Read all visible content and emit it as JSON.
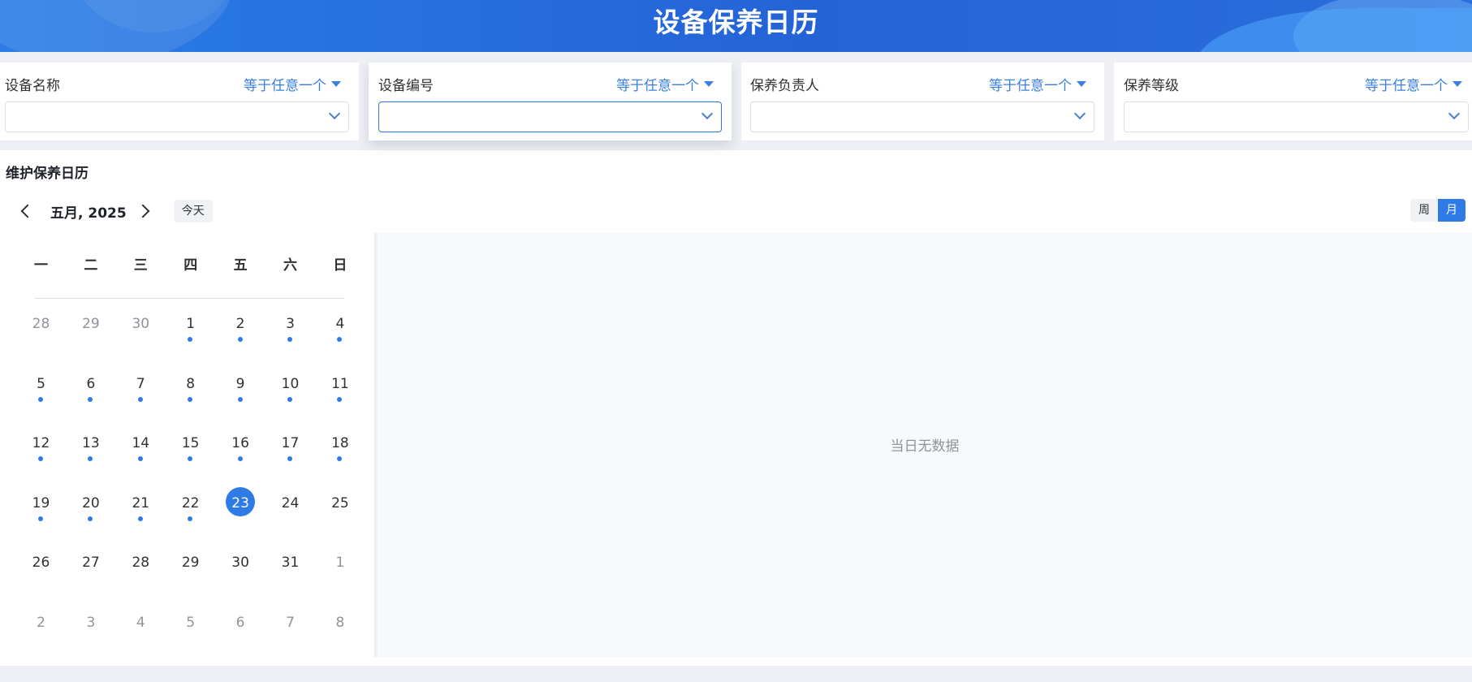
{
  "header": {
    "title": "设备保养日历"
  },
  "filters": [
    {
      "label": "设备名称",
      "operator": "等于任意一个"
    },
    {
      "label": "设备编号",
      "operator": "等于任意一个"
    },
    {
      "label": "保养负责人",
      "operator": "等于任意一个"
    },
    {
      "label": "保养等级",
      "operator": "等于任意一个"
    }
  ],
  "calendar": {
    "title": "维护保养日历",
    "month_label": "五月, 2025",
    "today_label": "今天",
    "view_week": "周",
    "view_month": "月",
    "active_view": "月",
    "weekdays": [
      "一",
      "二",
      "三",
      "四",
      "五",
      "六",
      "日"
    ],
    "days": [
      {
        "n": "28",
        "other": true,
        "dot": false
      },
      {
        "n": "29",
        "other": true,
        "dot": false
      },
      {
        "n": "30",
        "other": true,
        "dot": false
      },
      {
        "n": "1",
        "dot": true
      },
      {
        "n": "2",
        "dot": true
      },
      {
        "n": "3",
        "dot": true
      },
      {
        "n": "4",
        "dot": true
      },
      {
        "n": "5",
        "dot": true
      },
      {
        "n": "6",
        "dot": true
      },
      {
        "n": "7",
        "dot": true
      },
      {
        "n": "8",
        "dot": true
      },
      {
        "n": "9",
        "dot": true
      },
      {
        "n": "10",
        "dot": true
      },
      {
        "n": "11",
        "dot": true
      },
      {
        "n": "12",
        "dot": true
      },
      {
        "n": "13",
        "dot": true
      },
      {
        "n": "14",
        "dot": true
      },
      {
        "n": "15",
        "dot": true
      },
      {
        "n": "16",
        "dot": true
      },
      {
        "n": "17",
        "dot": true
      },
      {
        "n": "18",
        "dot": true
      },
      {
        "n": "19",
        "dot": true
      },
      {
        "n": "20",
        "dot": true
      },
      {
        "n": "21",
        "dot": true
      },
      {
        "n": "22",
        "dot": true
      },
      {
        "n": "23",
        "selected": true,
        "dot": false
      },
      {
        "n": "24",
        "dot": false
      },
      {
        "n": "25",
        "dot": false
      },
      {
        "n": "26",
        "dot": false
      },
      {
        "n": "27",
        "dot": false
      },
      {
        "n": "28",
        "dot": false
      },
      {
        "n": "29",
        "dot": false
      },
      {
        "n": "30",
        "dot": false
      },
      {
        "n": "31",
        "dot": false
      },
      {
        "n": "1",
        "other": true,
        "dot": false
      },
      {
        "n": "2",
        "other": true,
        "dot": false
      },
      {
        "n": "3",
        "other": true,
        "dot": false
      },
      {
        "n": "4",
        "other": true,
        "dot": false
      },
      {
        "n": "5",
        "other": true,
        "dot": false
      },
      {
        "n": "6",
        "other": true,
        "dot": false
      },
      {
        "n": "7",
        "other": true,
        "dot": false
      },
      {
        "n": "8",
        "other": true,
        "dot": false
      }
    ],
    "empty_text": "当日无数据"
  },
  "colors": {
    "accent": "#2f7be5",
    "header": "#2463d6"
  }
}
